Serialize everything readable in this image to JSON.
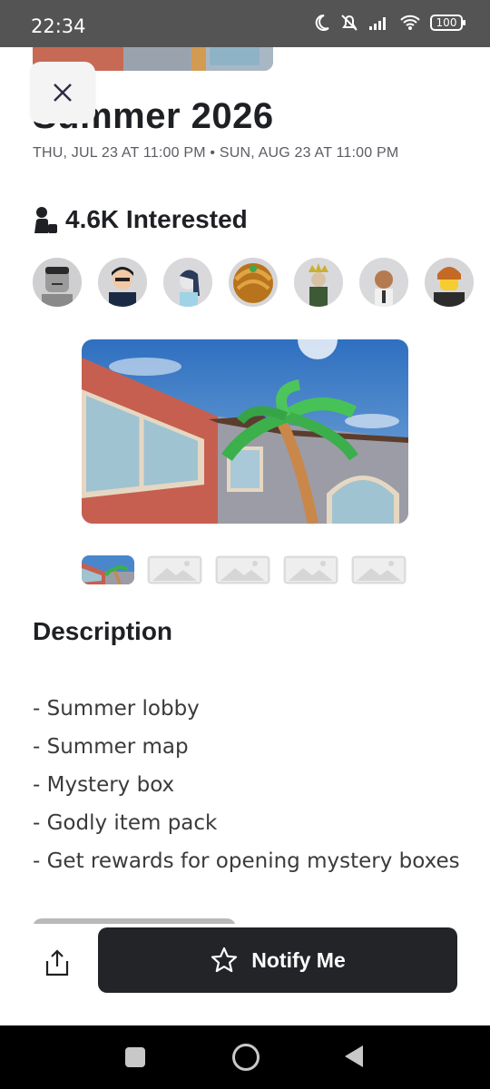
{
  "status_bar": {
    "time": "22:34",
    "battery": "100",
    "icons": [
      "moon-icon",
      "mute-bell-icon",
      "signal-icon",
      "wifi-icon",
      "battery-icon"
    ]
  },
  "event": {
    "title": "Summer 2026",
    "dates": "THU, JUL 23 AT 11:00 PM • SUN, AUG 23 AT 11:00 PM",
    "interested": "4.6K Interested"
  },
  "avatars_count": 7,
  "gallery": {
    "thumbnails": 5,
    "active_index": 0
  },
  "description": {
    "heading": "Description",
    "items": [
      "- Summer lobby",
      "- Summer map",
      "- Mystery box",
      "- Godly item pack",
      "- Get rewards for opening mystery boxes"
    ]
  },
  "actions": {
    "notify_label": "Notify Me"
  },
  "colors": {
    "primary_button": "#232427",
    "text": "#1f2024",
    "muted": "#5b5d63"
  }
}
